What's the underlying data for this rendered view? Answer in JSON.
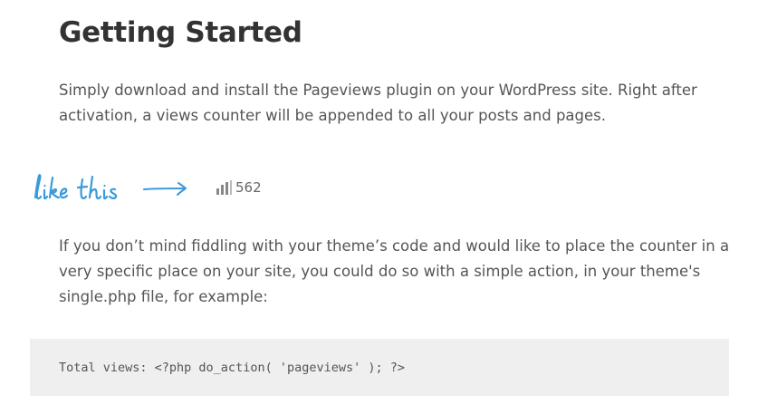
{
  "section": {
    "title": "Getting Started",
    "intro": "Simply download and install the Pageviews plugin on your WordPress site. Right after activation, a views counter will be appended to all your posts and pages.",
    "instructions": "If you don’t mind fiddling with your theme’s code and would like to place the counter in a very specific place on your site, you could do so with a simple action, in your theme's single.php file, for example:"
  },
  "demo": {
    "handwritten_label": "like this",
    "counter_icon": "bar-chart-icon",
    "counter_value": "562",
    "accent_color": "#3a9ad9"
  },
  "code": {
    "snippet": "Total views: <?php do_action( 'pageviews' ); ?>"
  }
}
